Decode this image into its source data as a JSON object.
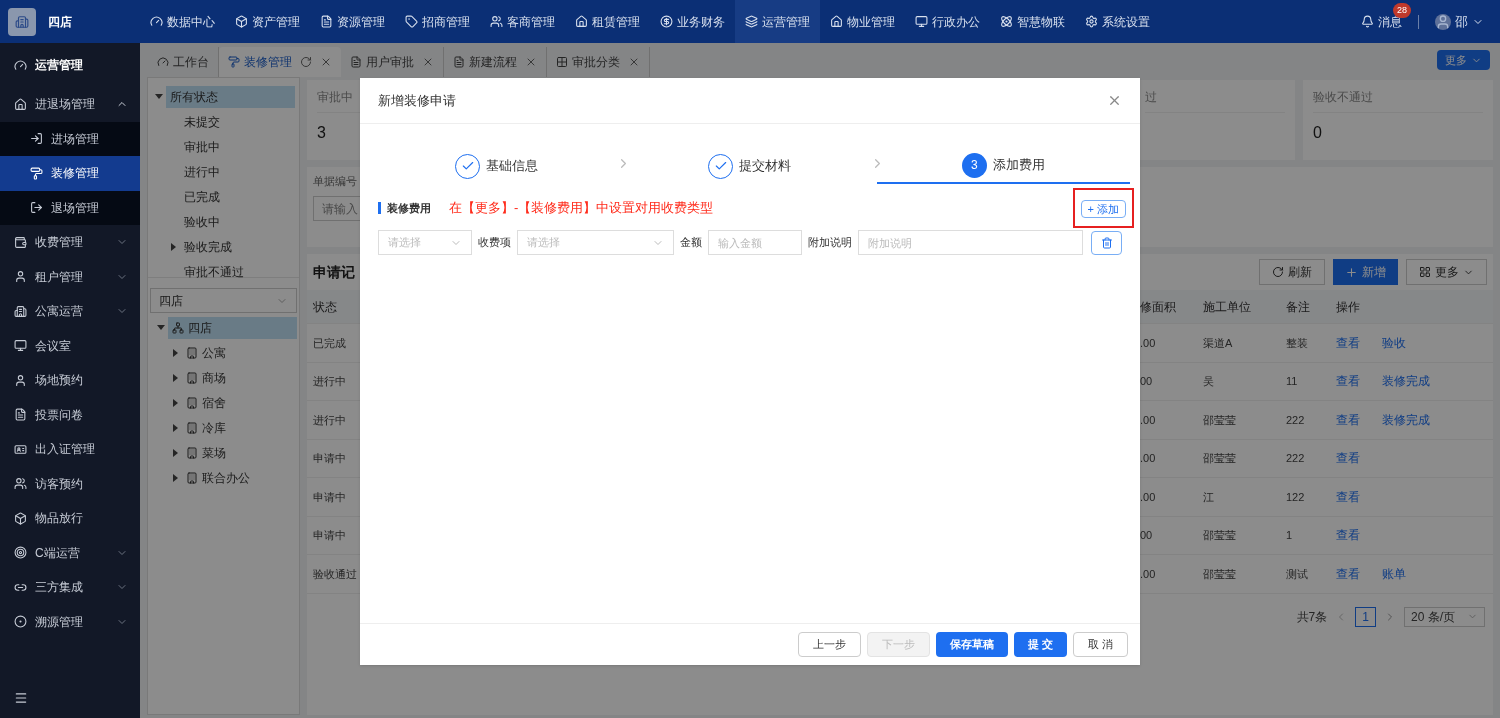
{
  "topbar": {
    "store": "四店",
    "nav": [
      {
        "label": "数据中心",
        "selected": false
      },
      {
        "label": "资产管理",
        "selected": false
      },
      {
        "label": "资源管理",
        "selected": false
      },
      {
        "label": "招商管理",
        "selected": false
      },
      {
        "label": "客商管理",
        "selected": false
      },
      {
        "label": "租赁管理",
        "selected": false
      },
      {
        "label": "业务财务",
        "selected": false
      },
      {
        "label": "运营管理",
        "selected": true
      },
      {
        "label": "物业管理",
        "selected": false
      },
      {
        "label": "行政办公",
        "selected": false
      },
      {
        "label": "智慧物联",
        "selected": false
      },
      {
        "label": "系统设置",
        "selected": false
      }
    ],
    "messages": {
      "label": "消息",
      "badge": "28"
    },
    "user": "邵"
  },
  "sidebar": {
    "title": "运营管理",
    "items": [
      {
        "label": "进退场管理",
        "kind": "group",
        "expanded": true,
        "children": [
          {
            "label": "进场管理",
            "selected": false
          },
          {
            "label": "装修管理",
            "selected": true
          },
          {
            "label": "退场管理",
            "selected": false
          }
        ]
      },
      {
        "label": "收费管理",
        "kind": "group",
        "expanded": false
      },
      {
        "label": "租户管理",
        "kind": "group",
        "expanded": false
      },
      {
        "label": "公寓运营",
        "kind": "group",
        "expanded": false
      },
      {
        "label": "会议室",
        "kind": "link"
      },
      {
        "label": "场地预约",
        "kind": "link"
      },
      {
        "label": "投票问卷",
        "kind": "link"
      },
      {
        "label": "出入证管理",
        "kind": "link"
      },
      {
        "label": "访客预约",
        "kind": "link"
      },
      {
        "label": "物品放行",
        "kind": "link"
      },
      {
        "label": "C端运营",
        "kind": "group",
        "expanded": false
      },
      {
        "label": "三方集成",
        "kind": "group",
        "expanded": false
      },
      {
        "label": "溯源管理",
        "kind": "group",
        "expanded": false
      }
    ]
  },
  "tabs": [
    {
      "label": "工作台",
      "selected": false,
      "closable": false
    },
    {
      "label": "装修管理",
      "selected": true,
      "closable": true
    },
    {
      "label": "用户审批",
      "selected": false,
      "closable": true
    },
    {
      "label": "新建流程",
      "selected": false,
      "closable": true
    },
    {
      "label": "审批分类",
      "selected": false,
      "closable": true
    }
  ],
  "tabs_more": "更多",
  "status_tree": [
    {
      "label": "所有状态",
      "selected": true,
      "expanded": true,
      "children": [
        {
          "label": "未提交",
          "selected": false
        },
        {
          "label": "审批中",
          "selected": false
        },
        {
          "label": "进行中",
          "selected": false
        },
        {
          "label": "已完成",
          "selected": false
        },
        {
          "label": "验收中",
          "selected": false
        },
        {
          "label": "验收完成",
          "selected": false,
          "expanded": false
        },
        {
          "label": "审批不通过",
          "selected": false
        }
      ]
    }
  ],
  "store_select": {
    "value": "四店"
  },
  "store_tree": [
    {
      "label": "四店",
      "selected": true,
      "expanded": true,
      "children": [
        {
          "label": "公寓",
          "selected": false,
          "expanded": false
        },
        {
          "label": "商场",
          "selected": false,
          "expanded": false
        },
        {
          "label": "宿舍",
          "selected": false,
          "expanded": false
        },
        {
          "label": "冷库",
          "selected": false,
          "expanded": false
        },
        {
          "label": "菜场",
          "selected": false,
          "expanded": false
        },
        {
          "label": "联合办公",
          "selected": false,
          "expanded": false
        }
      ]
    }
  ],
  "stats": [
    {
      "label": "审批中",
      "value": "3"
    },
    {
      "label": "过"
    },
    {
      "label": "验收不通过",
      "value": "0"
    }
  ],
  "search": {
    "label": "单据编号",
    "placeholder": "请输入"
  },
  "records": {
    "title": "申请记",
    "buttons": [
      {
        "label": "刷新",
        "kind": "refresh"
      },
      {
        "label": "新增",
        "kind": "add"
      },
      {
        "label": "更多",
        "kind": "more"
      }
    ],
    "columns": [
      "状态",
      "修面积",
      "施工单位",
      "备注",
      "操作"
    ],
    "rows": [
      {
        "status": "已完成",
        "area": ".00",
        "unit": "渠道A",
        "remark": "整装",
        "actions": [
          "查看",
          "验收"
        ]
      },
      {
        "status": "进行中",
        "area": "00",
        "unit": "吴",
        "remark": "11",
        "actions": [
          "查看",
          "装修完成"
        ]
      },
      {
        "status": "进行中",
        "area": ".00",
        "unit": "邵莹莹",
        "remark": "222",
        "actions": [
          "查看",
          "装修完成"
        ]
      },
      {
        "status": "申请中",
        "area": ".00",
        "unit": "邵莹莹",
        "remark": "222",
        "actions": [
          "查看"
        ]
      },
      {
        "status": "申请中",
        "area": ".00",
        "unit": "江",
        "remark": "122",
        "actions": [
          "查看"
        ]
      },
      {
        "status": "申请中",
        "area": "00",
        "unit": "邵莹莹",
        "remark": "1",
        "actions": [
          "查看"
        ]
      },
      {
        "status": "验收通过",
        "area": ".00",
        "unit": "邵莹莹",
        "remark": "测试",
        "actions": [
          "查看",
          "账单"
        ]
      }
    ],
    "pagination": {
      "total": "共7条",
      "page": "1",
      "page_size": "20 条/页"
    }
  },
  "dialog": {
    "title": "新增装修申请",
    "steps": [
      {
        "label": "基础信息",
        "kind": "done"
      },
      {
        "label": "提交材料",
        "kind": "done"
      },
      {
        "label": "添加费用",
        "number": "3",
        "kind": "active"
      }
    ],
    "section": "装修费用",
    "note": "在【更多】-【装修费用】中设置对用收费类型",
    "add_button": {
      "label": "+ 添加",
      "highlighted": true
    },
    "fee_row": {
      "type_placeholder": "请选择",
      "item_label": "收费项",
      "item_placeholder": "请选择",
      "amount_label": "金额",
      "amount_placeholder": "输入金额",
      "remark_label": "附加说明",
      "remark_placeholder": "附加说明"
    },
    "footer": [
      {
        "label": "上一步",
        "kind": "default",
        "disabled": false
      },
      {
        "label": "下一步",
        "kind": "default",
        "disabled": true
      },
      {
        "label": "保存草稿",
        "kind": "primary",
        "disabled": false
      },
      {
        "label": "提 交",
        "kind": "primary",
        "disabled": false
      },
      {
        "label": "取 消",
        "kind": "default",
        "disabled": false
      }
    ]
  }
}
